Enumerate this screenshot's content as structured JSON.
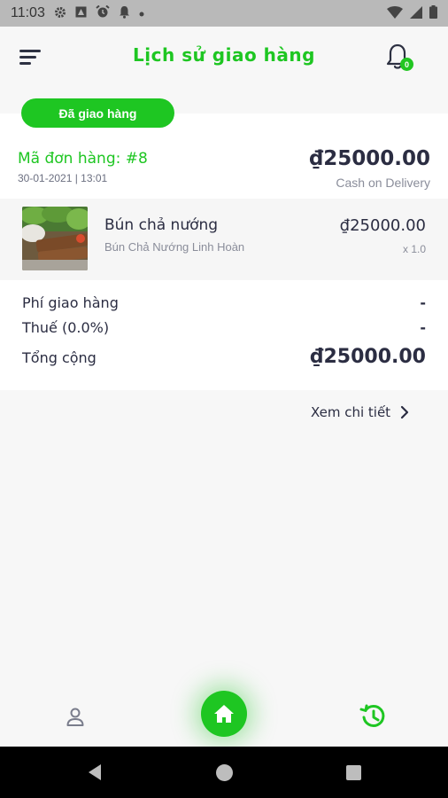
{
  "status_bar": {
    "time": "11:03",
    "icons": [
      "settings-icon",
      "storage-icon",
      "alarm-icon",
      "notification-icon",
      "dot-icon",
      "wifi-icon",
      "signal-icon",
      "battery-icon"
    ]
  },
  "header": {
    "title": "Lịch sử giao hàng",
    "notification_count": "0"
  },
  "order": {
    "status": "Đã giao hàng",
    "id_label": "Mã đơn hàng: #8",
    "date": "30-01-2021 | 13:01",
    "total": "₫25000.00",
    "payment_method": "Cash on Delivery",
    "item": {
      "name": "Bún chả nướng",
      "shop": "Bún Chả Nướng Linh Hoàn",
      "price": "₫25000.00",
      "quantity": "x 1.0"
    },
    "summary": {
      "delivery_fee_label": "Phí giao hàng",
      "delivery_fee_value": "-",
      "tax_label": "Thuế (0.0%)",
      "tax_value": "-",
      "total_label": "Tổng cộng",
      "total_value": "₫25000.00"
    },
    "detail_link": "Xem chi tiết"
  },
  "colors": {
    "accent": "#1ec622",
    "text": "#2b2d42",
    "muted": "#8a8d9a"
  }
}
